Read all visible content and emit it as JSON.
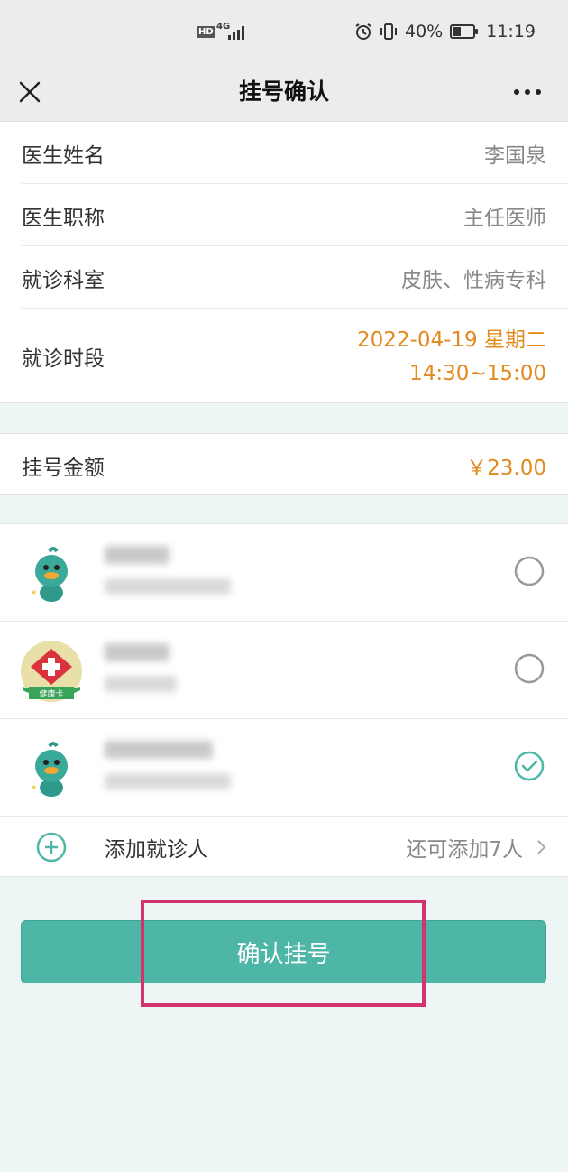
{
  "status_bar": {
    "hd": "HD",
    "network": "4G",
    "battery_level": "40%",
    "battery_fraction": 0.4,
    "time": "11:19"
  },
  "nav": {
    "title": "挂号确认",
    "close_icon": "close-icon",
    "more_icon": "more-icon"
  },
  "info": [
    {
      "label": "医生姓名",
      "value": "李国泉"
    },
    {
      "label": "医生职称",
      "value": "主任医师"
    },
    {
      "label": "就诊科室",
      "value": "皮肤、性病专科"
    }
  ],
  "schedule": {
    "label": "就诊时段",
    "date": "2022-04-19 星期二",
    "time": "14:30~15:00"
  },
  "fee": {
    "label": "挂号金额",
    "value": "￥23.00"
  },
  "patients": [
    {
      "avatar": "duck-avatar",
      "selected": false
    },
    {
      "avatar": "health-card-avatar",
      "badge": "健康卡",
      "selected": false
    },
    {
      "avatar": "duck-avatar",
      "selected": true
    }
  ],
  "add_patient": {
    "label": "添加就诊人",
    "hint": "还可添加7人"
  },
  "confirm_button": "确认挂号",
  "colors": {
    "accent": "#4db6a7",
    "orange": "#e28a1d",
    "highlight": "#d2336c"
  }
}
